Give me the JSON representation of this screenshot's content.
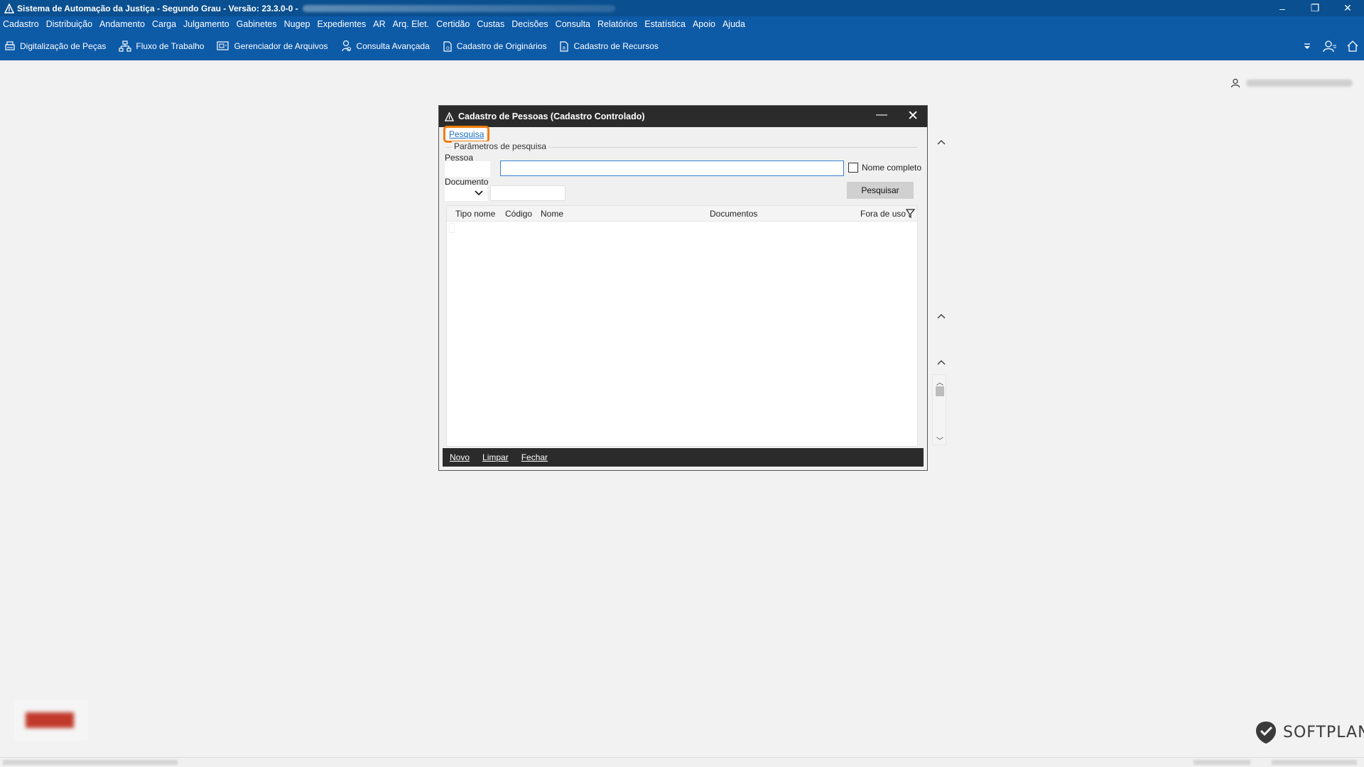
{
  "window": {
    "title": "Sistema de Automação da Justiça - Segundo Grau - Versão: 23.3.0-0 -",
    "controls": {
      "minimize": "–",
      "restore": "❐",
      "close": "✕"
    }
  },
  "menu": {
    "items": [
      "Cadastro",
      "Distribuição",
      "Andamento",
      "Carga",
      "Julgamento",
      "Gabinetes",
      "Nugep",
      "Expedientes",
      "AR",
      "Arq. Elet.",
      "Certidão",
      "Custas",
      "Decisões",
      "Consulta",
      "Relatórios",
      "Estatística",
      "Apoio",
      "Ajuda"
    ]
  },
  "toolbar": {
    "items": [
      {
        "label": "Digitalização de Peças",
        "icon": "scanner-icon"
      },
      {
        "label": "Fluxo de Trabalho",
        "icon": "workflow-icon"
      },
      {
        "label": "Gerenciador de Arquivos",
        "icon": "file-manager-icon"
      },
      {
        "label": "Consulta Avançada",
        "icon": "user-search-icon"
      },
      {
        "label": "Cadastro de Originários",
        "icon": "document-o-icon"
      },
      {
        "label": "Cadastro de Recursos",
        "icon": "document-r-icon"
      }
    ]
  },
  "dialog": {
    "title": "Cadastro de Pessoas (Cadastro Controlado)",
    "tab": "Pesquisa",
    "params_legend": "Parâmetros de pesquisa",
    "pessoa_label": "Pessoa",
    "documento_label": "Documento",
    "pessoa_value": "",
    "checkbox_label": "Nome completo",
    "search_button": "Pesquisar",
    "columns": [
      "Tipo nome",
      "Código",
      "Nome",
      "Documentos",
      "Fora de uso"
    ],
    "footer": [
      "Novo",
      "Limpar",
      "Fechar"
    ]
  },
  "branding": {
    "softplan": "SOFTPLAN"
  },
  "colors": {
    "titlebar": "#0a4f8f",
    "menubar": "#0d5aa7",
    "highlight": "#f07c0a",
    "dialog_title": "#2b2b2b"
  }
}
